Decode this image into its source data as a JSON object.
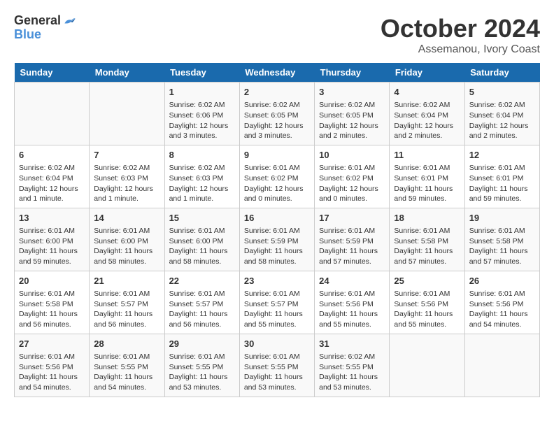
{
  "logo": {
    "line1": "General",
    "line2": "Blue"
  },
  "title": "October 2024",
  "subtitle": "Assemanou, Ivory Coast",
  "days_header": [
    "Sunday",
    "Monday",
    "Tuesday",
    "Wednesday",
    "Thursday",
    "Friday",
    "Saturday"
  ],
  "weeks": [
    [
      {
        "day": "",
        "info": ""
      },
      {
        "day": "",
        "info": ""
      },
      {
        "day": "1",
        "info": "Sunrise: 6:02 AM\nSunset: 6:06 PM\nDaylight: 12 hours and 3 minutes."
      },
      {
        "day": "2",
        "info": "Sunrise: 6:02 AM\nSunset: 6:05 PM\nDaylight: 12 hours and 3 minutes."
      },
      {
        "day": "3",
        "info": "Sunrise: 6:02 AM\nSunset: 6:05 PM\nDaylight: 12 hours and 2 minutes."
      },
      {
        "day": "4",
        "info": "Sunrise: 6:02 AM\nSunset: 6:04 PM\nDaylight: 12 hours and 2 minutes."
      },
      {
        "day": "5",
        "info": "Sunrise: 6:02 AM\nSunset: 6:04 PM\nDaylight: 12 hours and 2 minutes."
      }
    ],
    [
      {
        "day": "6",
        "info": "Sunrise: 6:02 AM\nSunset: 6:04 PM\nDaylight: 12 hours and 1 minute."
      },
      {
        "day": "7",
        "info": "Sunrise: 6:02 AM\nSunset: 6:03 PM\nDaylight: 12 hours and 1 minute."
      },
      {
        "day": "8",
        "info": "Sunrise: 6:02 AM\nSunset: 6:03 PM\nDaylight: 12 hours and 1 minute."
      },
      {
        "day": "9",
        "info": "Sunrise: 6:01 AM\nSunset: 6:02 PM\nDaylight: 12 hours and 0 minutes."
      },
      {
        "day": "10",
        "info": "Sunrise: 6:01 AM\nSunset: 6:02 PM\nDaylight: 12 hours and 0 minutes."
      },
      {
        "day": "11",
        "info": "Sunrise: 6:01 AM\nSunset: 6:01 PM\nDaylight: 11 hours and 59 minutes."
      },
      {
        "day": "12",
        "info": "Sunrise: 6:01 AM\nSunset: 6:01 PM\nDaylight: 11 hours and 59 minutes."
      }
    ],
    [
      {
        "day": "13",
        "info": "Sunrise: 6:01 AM\nSunset: 6:00 PM\nDaylight: 11 hours and 59 minutes."
      },
      {
        "day": "14",
        "info": "Sunrise: 6:01 AM\nSunset: 6:00 PM\nDaylight: 11 hours and 58 minutes."
      },
      {
        "day": "15",
        "info": "Sunrise: 6:01 AM\nSunset: 6:00 PM\nDaylight: 11 hours and 58 minutes."
      },
      {
        "day": "16",
        "info": "Sunrise: 6:01 AM\nSunset: 5:59 PM\nDaylight: 11 hours and 58 minutes."
      },
      {
        "day": "17",
        "info": "Sunrise: 6:01 AM\nSunset: 5:59 PM\nDaylight: 11 hours and 57 minutes."
      },
      {
        "day": "18",
        "info": "Sunrise: 6:01 AM\nSunset: 5:58 PM\nDaylight: 11 hours and 57 minutes."
      },
      {
        "day": "19",
        "info": "Sunrise: 6:01 AM\nSunset: 5:58 PM\nDaylight: 11 hours and 57 minutes."
      }
    ],
    [
      {
        "day": "20",
        "info": "Sunrise: 6:01 AM\nSunset: 5:58 PM\nDaylight: 11 hours and 56 minutes."
      },
      {
        "day": "21",
        "info": "Sunrise: 6:01 AM\nSunset: 5:57 PM\nDaylight: 11 hours and 56 minutes."
      },
      {
        "day": "22",
        "info": "Sunrise: 6:01 AM\nSunset: 5:57 PM\nDaylight: 11 hours and 56 minutes."
      },
      {
        "day": "23",
        "info": "Sunrise: 6:01 AM\nSunset: 5:57 PM\nDaylight: 11 hours and 55 minutes."
      },
      {
        "day": "24",
        "info": "Sunrise: 6:01 AM\nSunset: 5:56 PM\nDaylight: 11 hours and 55 minutes."
      },
      {
        "day": "25",
        "info": "Sunrise: 6:01 AM\nSunset: 5:56 PM\nDaylight: 11 hours and 55 minutes."
      },
      {
        "day": "26",
        "info": "Sunrise: 6:01 AM\nSunset: 5:56 PM\nDaylight: 11 hours and 54 minutes."
      }
    ],
    [
      {
        "day": "27",
        "info": "Sunrise: 6:01 AM\nSunset: 5:56 PM\nDaylight: 11 hours and 54 minutes."
      },
      {
        "day": "28",
        "info": "Sunrise: 6:01 AM\nSunset: 5:55 PM\nDaylight: 11 hours and 54 minutes."
      },
      {
        "day": "29",
        "info": "Sunrise: 6:01 AM\nSunset: 5:55 PM\nDaylight: 11 hours and 53 minutes."
      },
      {
        "day": "30",
        "info": "Sunrise: 6:01 AM\nSunset: 5:55 PM\nDaylight: 11 hours and 53 minutes."
      },
      {
        "day": "31",
        "info": "Sunrise: 6:02 AM\nSunset: 5:55 PM\nDaylight: 11 hours and 53 minutes."
      },
      {
        "day": "",
        "info": ""
      },
      {
        "day": "",
        "info": ""
      }
    ]
  ]
}
